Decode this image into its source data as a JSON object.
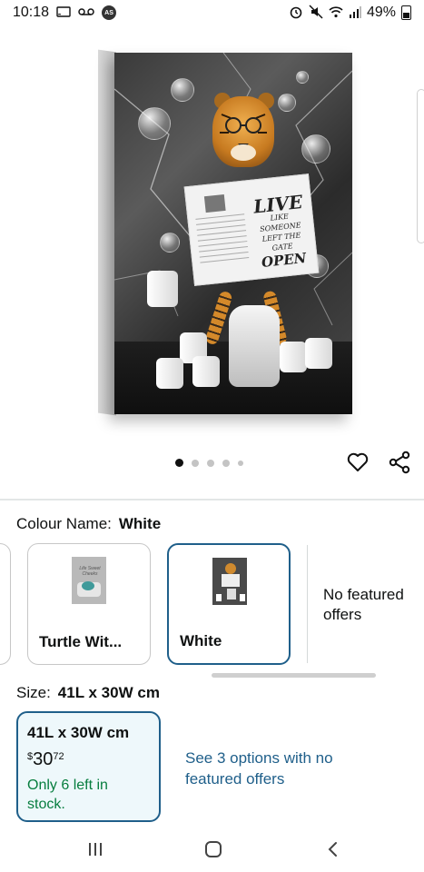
{
  "status_bar": {
    "time": "10:18",
    "battery": "49%",
    "icons": [
      "screen-cast-icon",
      "voicemail-icon",
      "as-badge-icon",
      "alarm-icon",
      "mute-icon",
      "wifi-icon",
      "signal-icon",
      "battery-icon"
    ],
    "badge": "AS"
  },
  "product_image": {
    "newspaper_text": [
      "LIVE",
      "LIKE SOMEONE",
      "LEFT THE GATE",
      "OPEN"
    ],
    "carousel": {
      "count": 5,
      "active_index": 0
    }
  },
  "actions": {
    "icons": [
      "heart-icon",
      "share-icon"
    ]
  },
  "colour": {
    "label": "Colour Name:",
    "value": "White",
    "options": [
      {
        "label": "Turtle Wit...",
        "thumb_text": "Life Sweet Cheeks"
      },
      {
        "label": "White",
        "selected": true
      }
    ],
    "no_featured": "No featured offers"
  },
  "size": {
    "label": "Size:",
    "value": "41L x 30W cm",
    "card": {
      "title": "41L x 30W cm",
      "price_symbol": "$",
      "price_whole": "30",
      "price_cents": "72",
      "stock": "Only 6 left in stock."
    },
    "see_options": "See 3 options with no featured offers"
  },
  "colors": {
    "accent": "#1f5f8a",
    "in_stock": "#067d3e",
    "selected_bg": "#eef8fb"
  },
  "nav": {
    "icons": [
      "recent-apps-icon",
      "home-icon",
      "back-icon"
    ]
  }
}
